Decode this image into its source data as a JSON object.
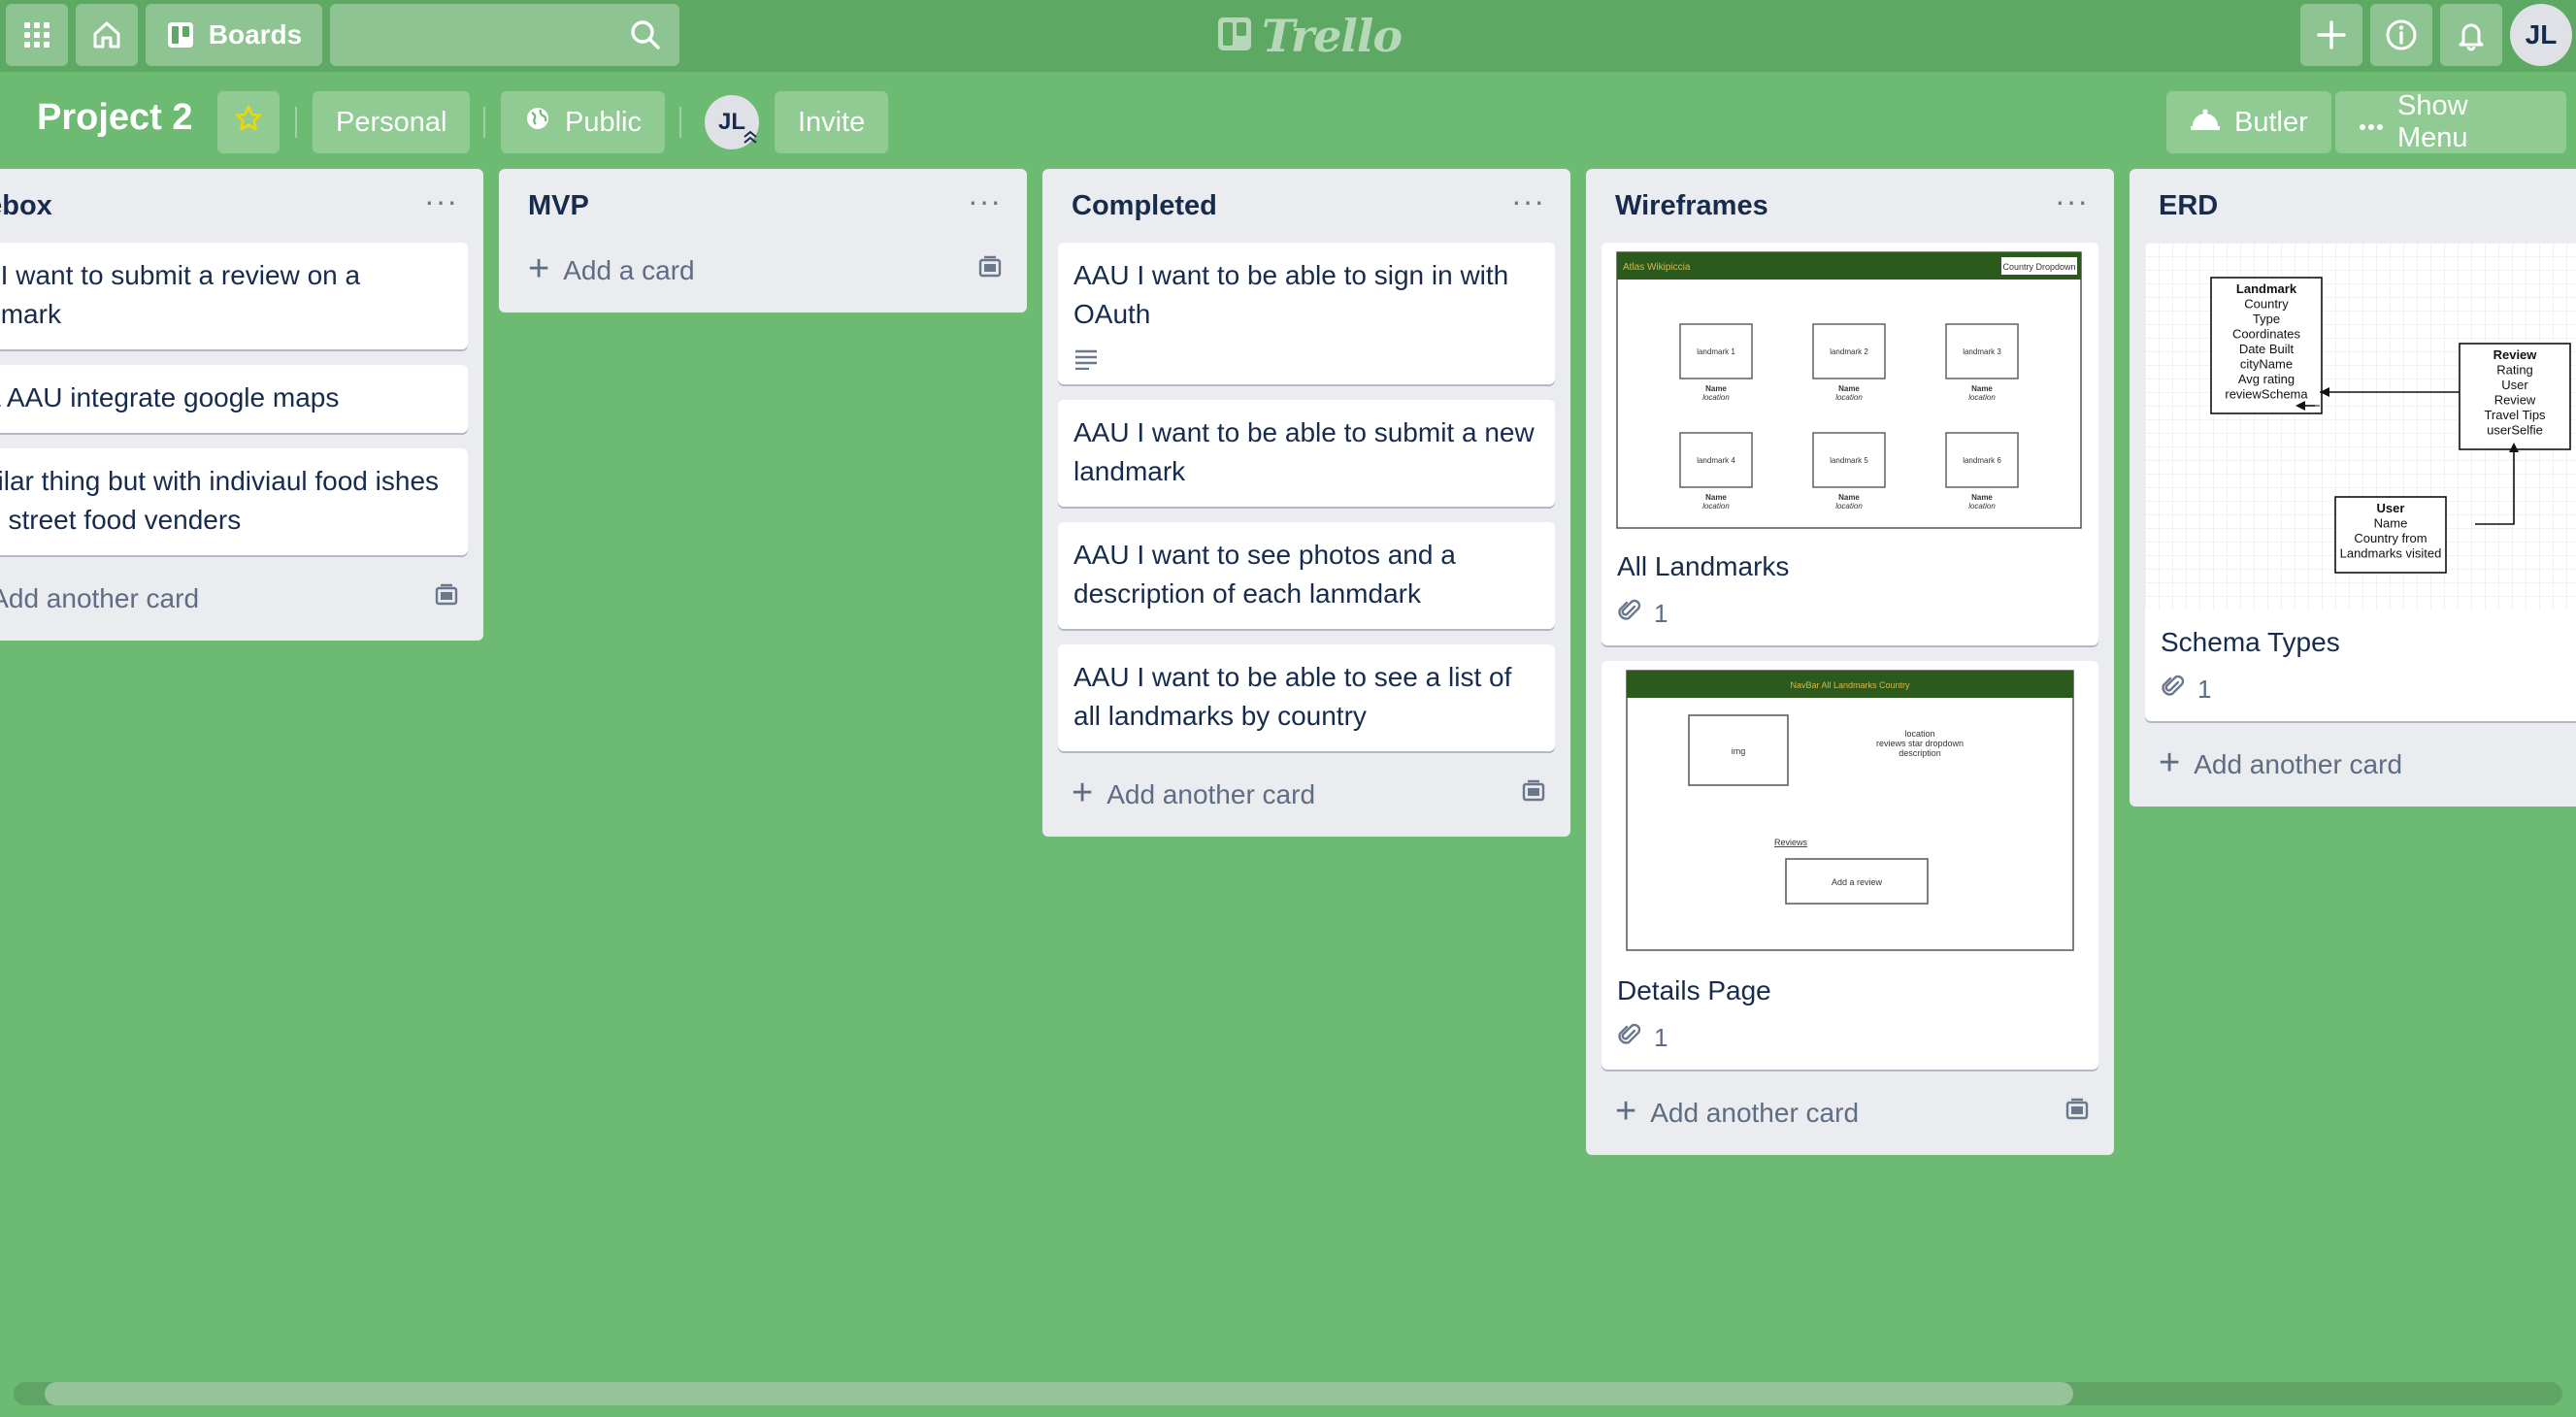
{
  "header": {
    "boards_label": "Boards",
    "search_value": "",
    "logo_text": "Trello",
    "user_initials": "JL"
  },
  "board": {
    "title": "Project 2",
    "visibility_team": "Personal",
    "visibility": "Public",
    "member_initials": "JL",
    "invite_label": "Invite",
    "butler_label": "Butler",
    "show_menu_label": "Show Menu"
  },
  "lists": [
    {
      "title": "cebox",
      "cards": [
        "AU I want to submit a review on a andmark",
        "xtra AAU integrate google maps",
        " similar thing but with indiviaul food ishes and street food venders"
      ],
      "add_label": "Add another card"
    },
    {
      "title": "MVP",
      "cards": [],
      "add_label": "Add a card"
    },
    {
      "title": "Completed",
      "cards": [
        "AAU I want to be able to sign in with OAuth",
        "AAU I want to be able to submit a new landmark",
        "AAU I want to see photos and a description of each lanmdark",
        "AAU I want to be able to see a list of all landmarks by country"
      ],
      "add_label": "Add another card"
    },
    {
      "title": "Wireframes",
      "cards": [
        {
          "title": "All Landmarks",
          "attachments": "1"
        },
        {
          "title": "Details Page",
          "attachments": "1"
        }
      ],
      "add_label": "Add another card"
    },
    {
      "title": "ERD",
      "cards": [
        {
          "title": "Schema Types",
          "attachments": "1"
        }
      ],
      "add_label": "Add another card"
    }
  ],
  "wireframe_all": {
    "brand": "Atlas Wikipiccia",
    "dropdown": "Country Dropdown",
    "tiles": [
      "landmark 1",
      "landmark 2",
      "landmark 3",
      "landmark 4",
      "landmark 5",
      "landmark 6"
    ],
    "tile_name": "Name",
    "tile_location": "location"
  },
  "wireframe_details": {
    "nav": "NavBar   All Landmarks Country",
    "img": "img",
    "info_1": "location",
    "info_2": "reviews  star dropdown",
    "info_3": "description",
    "reviews": "Reviews",
    "add_review": "Add a review"
  },
  "erd": {
    "landmark_title": "Landmark",
    "landmark_fields": [
      "Country",
      "Type",
      "Coordinates",
      "Date Built",
      "cityName",
      "Avg rating",
      "reviewSchema"
    ],
    "review_title": "Review",
    "review_fields": [
      "Rating",
      "User",
      "Review",
      "Travel Tips",
      "userSelfie"
    ],
    "user_title": "User",
    "user_fields": [
      "Name",
      "Country from",
      "Landmarks visited"
    ]
  },
  "colors": {
    "board_bg": "#6dbb72",
    "header_bg": "#5da963",
    "list_bg": "#ebecf0",
    "star": "#f2d600",
    "wireframe_bar": "#2c5a1d"
  }
}
